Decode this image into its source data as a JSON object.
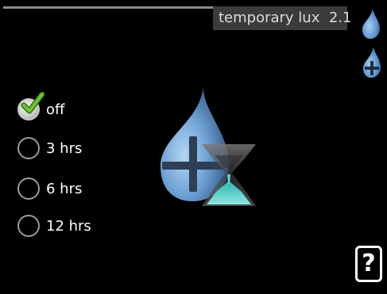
{
  "header": {
    "title": "temporary lux",
    "menu_number": "2.1"
  },
  "options": [
    {
      "label": "off",
      "selected": true
    },
    {
      "label": "3 hrs",
      "selected": false
    },
    {
      "label": "6 hrs",
      "selected": false
    },
    {
      "label": "12 hrs",
      "selected": false
    }
  ],
  "icons": {
    "side_top": "water-drop-icon",
    "side_bottom": "water-drop-plus-icon",
    "hero": "water-drop-plus-hourglass-icon",
    "help": "help-icon"
  },
  "help": {
    "label": "?"
  },
  "colors": {
    "background": "#000000",
    "title_bg": "#3b3b3b",
    "check_green": "#5fb327",
    "drop_blue": "#6fa3d6",
    "hourglass_teal": "#3fc6c0"
  }
}
